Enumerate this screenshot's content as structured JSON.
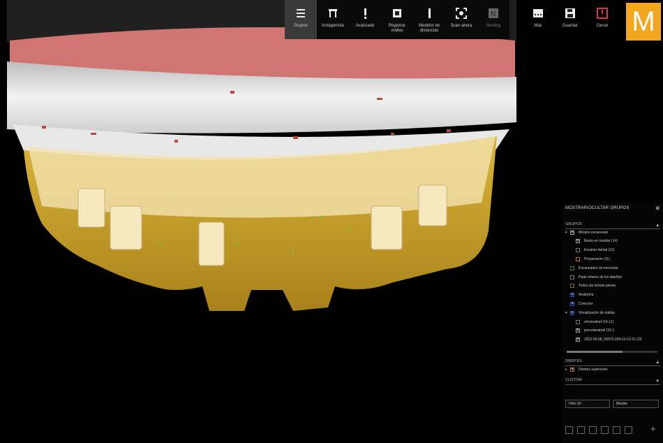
{
  "toolbar": {
    "items": [
      {
        "label": "Grupos",
        "icon": "hamburger-icon"
      },
      {
        "label": "Antagonista",
        "icon": "antagonist-icon"
      },
      {
        "label": "Avanzado",
        "icon": "exclamation-icon"
      },
      {
        "label": "Registrar\nmallas",
        "icon": "register-meshes-icon"
      },
      {
        "label": "Medidor de\ndistancias",
        "icon": "distance-meter-icon"
      },
      {
        "label": "Scan ahora",
        "icon": "scan-icon"
      },
      {
        "label": "Nesting",
        "icon": "nesting-icon"
      }
    ],
    "secondary": [
      {
        "label": "Más",
        "icon": "more-icon"
      },
      {
        "label": "Guardar",
        "icon": "save-icon"
      },
      {
        "label": "Cerrar",
        "icon": "power-icon"
      }
    ],
    "logo_letter": "M"
  },
  "panel": {
    "title": "MOSTRAR/OCULTAR GRUPOS",
    "close": "✕",
    "groups_header": "GRUPOS",
    "groups": [
      {
        "label": "Modelo escaneado",
        "indent": 0,
        "tri": "▾",
        "checked": true
      },
      {
        "label": "Resto en maxilar (14)",
        "indent": 1,
        "checked": true
      },
      {
        "label": "Escáner dental (11)",
        "indent": 1,
        "checked": false
      },
      {
        "label": "Preparación (11)",
        "indent": 1,
        "checked": false
      },
      {
        "label": "Escaneados de encerado",
        "indent": 0,
        "checked": false
      },
      {
        "label": "Parte inferior de los diseños",
        "indent": 0,
        "checked": false
      },
      {
        "label": "Todas las demás piezas",
        "indent": 0,
        "checked": false
      },
      {
        "label": "Anatomía",
        "indent": 0,
        "checked": true
      },
      {
        "label": "Conector",
        "indent": 0,
        "checked": true
      },
      {
        "label": "Visualización de mallas",
        "indent": 0,
        "tri": "▾",
        "checked": true
      },
      {
        "label": "emomabutt (16-11)",
        "indent": 1,
        "checked": false
      },
      {
        "label": "porcelanabutt (16-1",
        "indent": 1,
        "checked": true
      },
      {
        "label": "2022-09-08_00070-004-13-13-15 (23",
        "indent": 1,
        "checked": true
      }
    ],
    "teeth_header": "DIENTES",
    "teeth": [
      {
        "label": "Dientes superiores",
        "tri": "▸",
        "checked": true
      }
    ],
    "custom_header": "CUSTOM",
    "field_left": "Hàm Xẻ",
    "field_right": "Maxilar"
  },
  "colors": {
    "accent": "#f2a51f",
    "gum": "#c9706e",
    "model_white": "#e4e4e4",
    "tooth_gold": "#c9a12c",
    "abutment_cream": "#f4e3b2",
    "close_red": "#d23b3b",
    "check_blue": "#2355d6"
  }
}
